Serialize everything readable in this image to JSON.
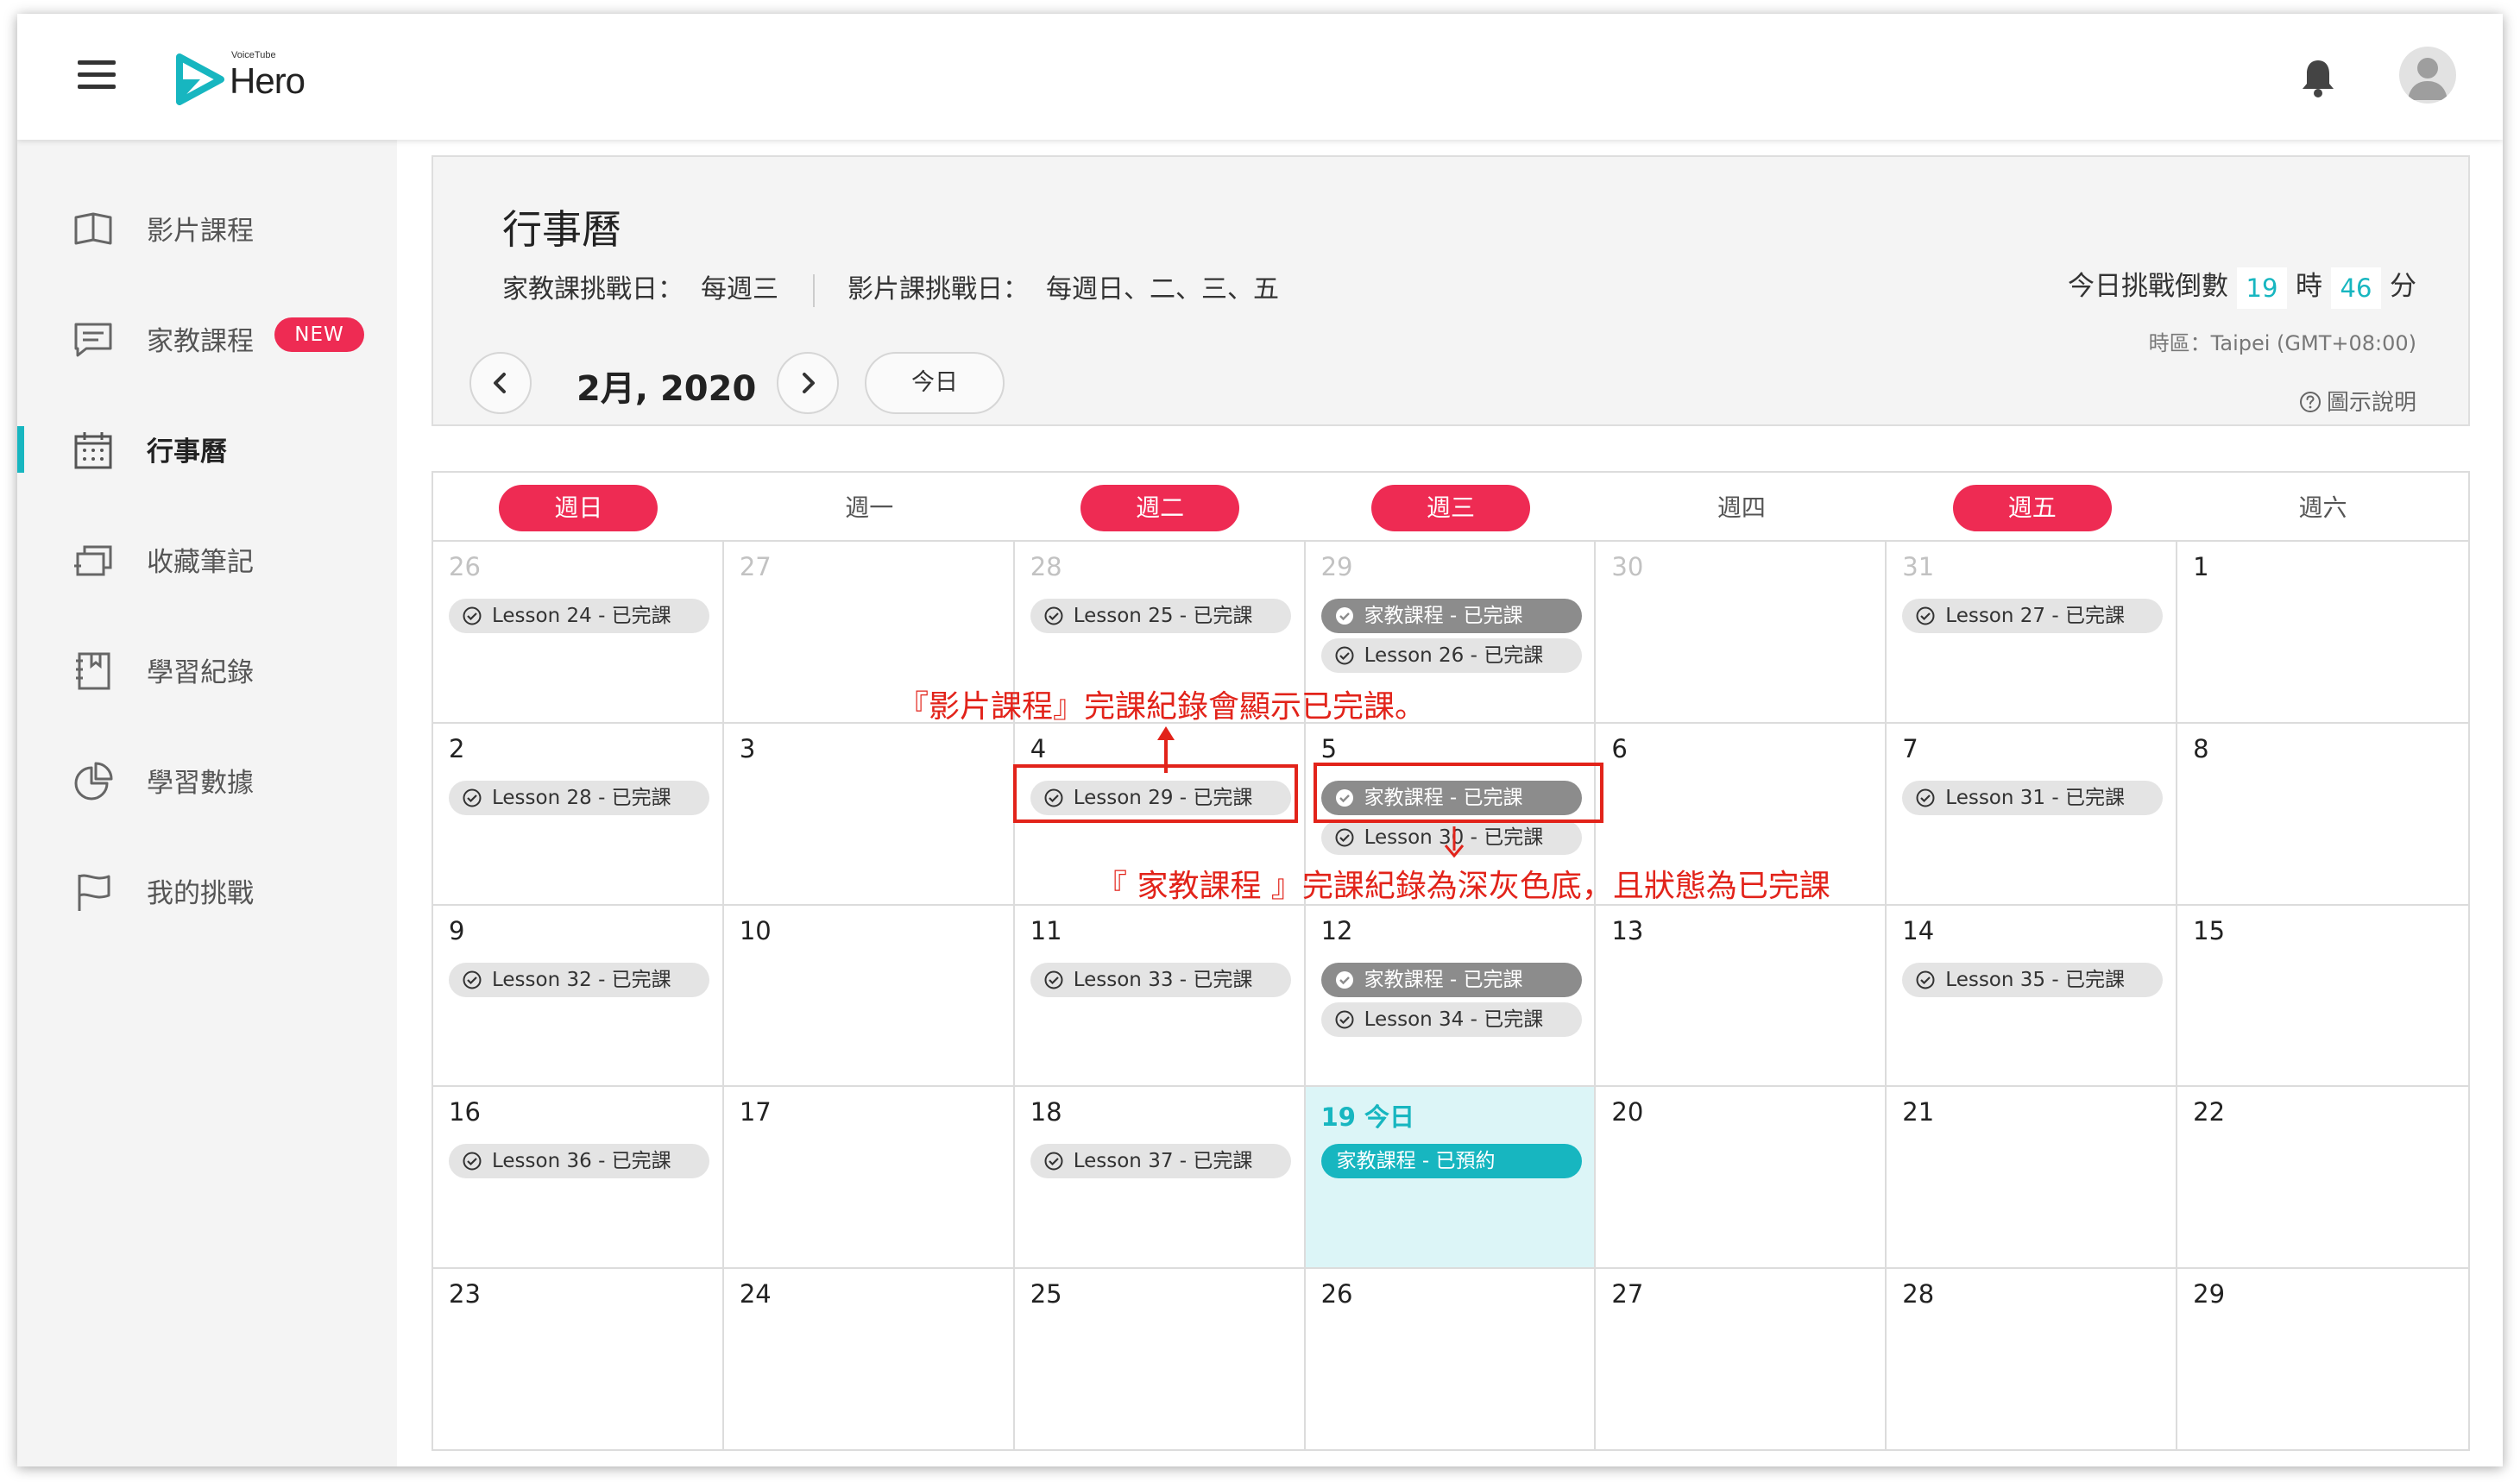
{
  "header": {
    "logo_small": "VoiceTube",
    "logo_text": "Hero"
  },
  "sidebar": {
    "items": [
      {
        "label": "影片課程",
        "icon": "book-icon"
      },
      {
        "label": "家教課程",
        "icon": "chat-icon",
        "badge": "NEW"
      },
      {
        "label": "行事曆",
        "icon": "calendar-icon",
        "active": true
      },
      {
        "label": "收藏筆記",
        "icon": "cards-icon"
      },
      {
        "label": "學習紀錄",
        "icon": "notebook-icon"
      },
      {
        "label": "學習數據",
        "icon": "pie-chart-icon"
      },
      {
        "label": "我的挑戰",
        "icon": "flag-icon"
      }
    ]
  },
  "panel": {
    "title": "行事曆",
    "tutor_label": "家教課挑戰日：",
    "tutor_value": "每週三",
    "video_label": "影片課挑戰日：",
    "video_value": "每週日、二、三、五",
    "month_label": "2月, 2020",
    "today_button": "今日",
    "countdown_label": "今日挑戰倒數",
    "countdown_hours": "19",
    "hours_unit": "時",
    "countdown_minutes": "46",
    "minutes_unit": "分",
    "timezone": "時區：Taipei (GMT+08:00)",
    "legend_help": "圖示說明"
  },
  "calendar": {
    "weekdays": [
      {
        "label": "週日",
        "challenge": true
      },
      {
        "label": "週一",
        "challenge": false
      },
      {
        "label": "週二",
        "challenge": true
      },
      {
        "label": "週三",
        "challenge": true
      },
      {
        "label": "週四",
        "challenge": false
      },
      {
        "label": "週五",
        "challenge": true
      },
      {
        "label": "週六",
        "challenge": false
      }
    ],
    "weeks": [
      [
        {
          "day": "26",
          "other": true,
          "events": [
            {
              "type": "light",
              "text": "Lesson 24 - 已完課"
            }
          ]
        },
        {
          "day": "27",
          "other": true,
          "events": []
        },
        {
          "day": "28",
          "other": true,
          "events": [
            {
              "type": "light",
              "text": "Lesson 25 - 已完課"
            }
          ]
        },
        {
          "day": "29",
          "other": true,
          "events": [
            {
              "type": "dark",
              "text": "家教課程 - 已完課"
            },
            {
              "type": "light",
              "text": "Lesson 26 - 已完課"
            }
          ]
        },
        {
          "day": "30",
          "other": true,
          "events": []
        },
        {
          "day": "31",
          "other": true,
          "events": [
            {
              "type": "light",
              "text": "Lesson 27 - 已完課"
            }
          ]
        },
        {
          "day": "1",
          "events": []
        }
      ],
      [
        {
          "day": "2",
          "events": [
            {
              "type": "light",
              "text": "Lesson 28 - 已完課"
            }
          ]
        },
        {
          "day": "3",
          "events": []
        },
        {
          "day": "4",
          "events": [
            {
              "type": "light",
              "text": "Lesson 29 - 已完課"
            }
          ]
        },
        {
          "day": "5",
          "events": [
            {
              "type": "dark",
              "text": "家教課程 - 已完課"
            },
            {
              "type": "light",
              "text": "Lesson 30 - 已完課"
            }
          ]
        },
        {
          "day": "6",
          "events": []
        },
        {
          "day": "7",
          "events": [
            {
              "type": "light",
              "text": "Lesson 31 - 已完課"
            }
          ]
        },
        {
          "day": "8",
          "events": []
        }
      ],
      [
        {
          "day": "9",
          "events": [
            {
              "type": "light",
              "text": "Lesson 32 - 已完課"
            }
          ]
        },
        {
          "day": "10",
          "events": []
        },
        {
          "day": "11",
          "events": [
            {
              "type": "light",
              "text": "Lesson 33 - 已完課"
            }
          ]
        },
        {
          "day": "12",
          "events": [
            {
              "type": "dark",
              "text": "家教課程 - 已完課"
            },
            {
              "type": "light",
              "text": "Lesson 34 - 已完課"
            }
          ]
        },
        {
          "day": "13",
          "events": []
        },
        {
          "day": "14",
          "events": [
            {
              "type": "light",
              "text": "Lesson 35 - 已完課"
            }
          ]
        },
        {
          "day": "15",
          "events": []
        }
      ],
      [
        {
          "day": "16",
          "events": [
            {
              "type": "light",
              "text": "Lesson 36 - 已完課"
            }
          ]
        },
        {
          "day": "17",
          "events": []
        },
        {
          "day": "18",
          "events": [
            {
              "type": "light",
              "text": "Lesson 37 - 已完課"
            }
          ]
        },
        {
          "day": "19 今日",
          "today": true,
          "events": [
            {
              "type": "booked",
              "text": "家教課程 - 已預約"
            }
          ]
        },
        {
          "day": "20",
          "events": []
        },
        {
          "day": "21",
          "events": []
        },
        {
          "day": "22",
          "events": []
        }
      ],
      [
        {
          "day": "23",
          "events": []
        },
        {
          "day": "24",
          "events": []
        },
        {
          "day": "25",
          "events": []
        },
        {
          "day": "26",
          "events": []
        },
        {
          "day": "27",
          "events": []
        },
        {
          "day": "28",
          "events": []
        },
        {
          "day": "29",
          "events": []
        }
      ]
    ]
  },
  "annotations": {
    "video_note": "『影片課程』完課紀錄會顯示已完課。",
    "tutor_note": "『 家教課程 』完課紀錄為深灰色底，且狀態為已完課"
  },
  "colors": {
    "accent": "#17b6c0",
    "brand_red": "#ee2b53",
    "annotation_red": "#e2231a",
    "dark_event": "#8c8c8c",
    "light_event": "#e4e4e4",
    "today_bg": "#dcf5f7"
  }
}
